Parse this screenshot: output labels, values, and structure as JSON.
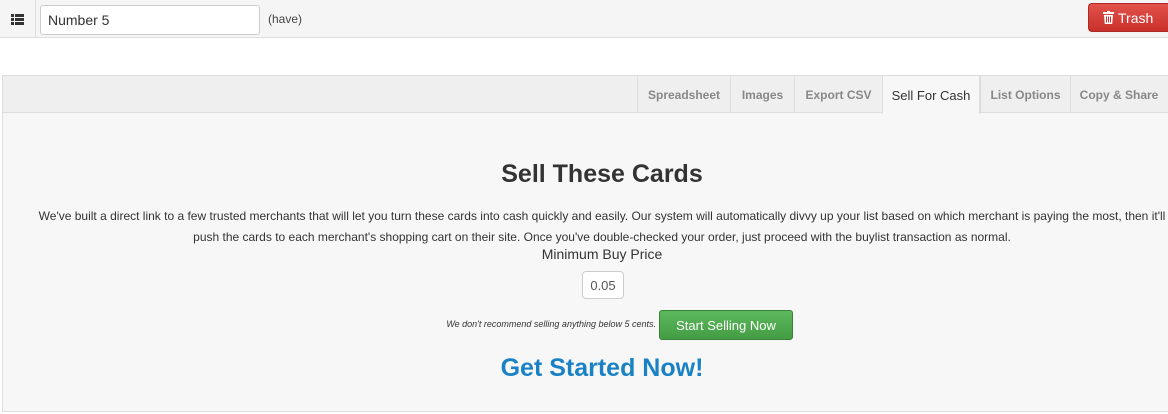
{
  "topbar": {
    "list_toggle_icon": "list-icon",
    "list_name_value": "Number 5",
    "list_type": "(have)",
    "trash_label": "Trash",
    "trash_icon": "trash-icon"
  },
  "tabs": [
    {
      "label": "Spreadsheet"
    },
    {
      "label": "Images"
    },
    {
      "label": "Export CSV"
    },
    {
      "label": "Sell For Cash"
    },
    {
      "label": "List Options"
    },
    {
      "label": "Copy & Share"
    }
  ],
  "active_tab": "Sell For Cash",
  "sell": {
    "heading": "Sell These Cards",
    "description_line1": "We've built a direct link to a few trusted merchants that will let you turn these cards into cash quickly and easily. Our system will automatically divvy up your list based on which merchant is paying the most, then it'll",
    "description_line2": "push the cards to each merchant's shopping cart on their site. Once you've double-checked your order, just proceed with the buylist transaction as normal.",
    "min_price_label": "Minimum Buy Price",
    "min_price_value": "0.05",
    "note": "We don't recommend selling anything below 5 cents.",
    "start_button": "Start Selling Now",
    "get_started": "Get Started Now!"
  },
  "colors": {
    "trash": "#d9534f",
    "start": "#5cb85c",
    "get_started": "#1a82c4"
  }
}
